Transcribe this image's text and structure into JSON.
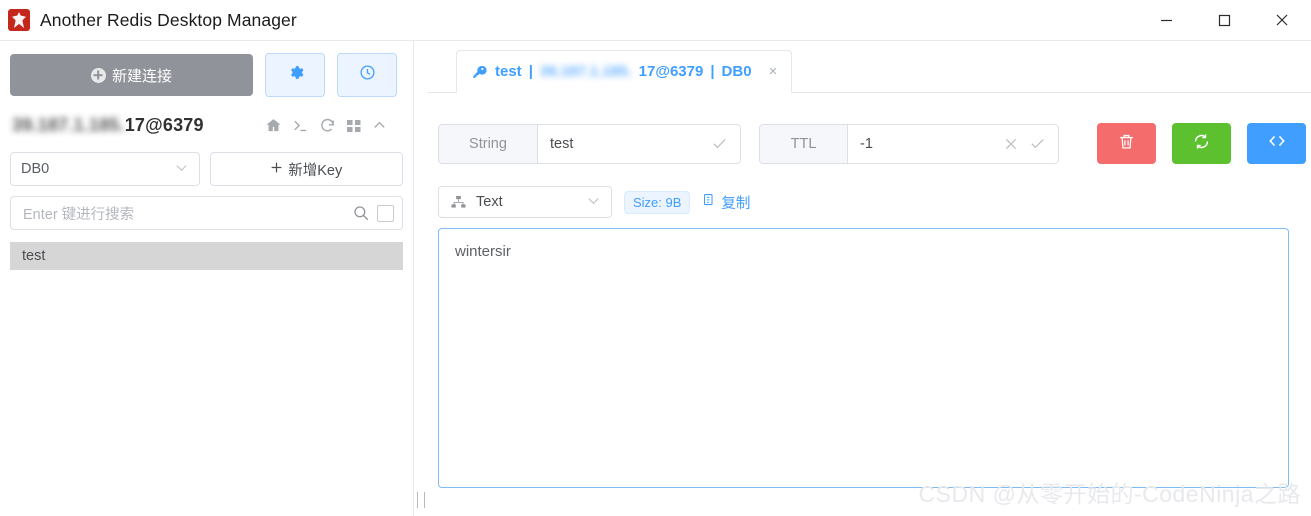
{
  "window": {
    "title": "Another Redis Desktop Manager",
    "app_icon": "redis-logo-icon",
    "minimize": "minimize-icon",
    "maximize": "maximize-icon",
    "close": "close-icon"
  },
  "sidebar": {
    "new_connection_label": "新建连接",
    "settings_icon": "gear-icon",
    "history_icon": "clock-icon",
    "server": {
      "name_prefix": "39.187.1.185.",
      "name_suffix": "17@6379",
      "tools": [
        {
          "name": "home-icon"
        },
        {
          "name": "console-icon"
        },
        {
          "name": "refresh-icon"
        },
        {
          "name": "grid-icon"
        },
        {
          "name": "chevron-up-icon"
        }
      ]
    },
    "db_select_value": "DB0",
    "add_key_label": "新增Key",
    "search_placeholder": "Enter 键进行搜索",
    "keys": [
      {
        "label": "test",
        "selected": true
      }
    ]
  },
  "main": {
    "tab": {
      "icon": "key-icon",
      "key_name": "test",
      "separator": "|",
      "host_blurred": "39.187.1.185.",
      "host_visible": "17@6379",
      "db": "DB0",
      "close": "×"
    },
    "key_header": {
      "type_label": "String",
      "key_value": "test",
      "key_confirm_icon": "check-icon",
      "ttl_label": "TTL",
      "ttl_value": "-1",
      "ttl_clear_icon": "close-icon",
      "ttl_confirm_icon": "check-icon",
      "actions": [
        {
          "name": "delete-key-button",
          "icon": "trash-icon",
          "color": "#f56c6c"
        },
        {
          "name": "refresh-key-button",
          "icon": "refresh-icon",
          "color": "#5dc02e"
        },
        {
          "name": "code-view-button",
          "icon": "code-icon",
          "color": "#409eff"
        }
      ]
    },
    "viewer": {
      "format_icon": "tree-icon",
      "format_value": "Text",
      "size_badge": "Size: 9B",
      "copy_icon": "copy-icon",
      "copy_label": "复制",
      "value": "wintersir"
    }
  },
  "watermark": "CSDN @从零开始的-CodeNinja之路"
}
